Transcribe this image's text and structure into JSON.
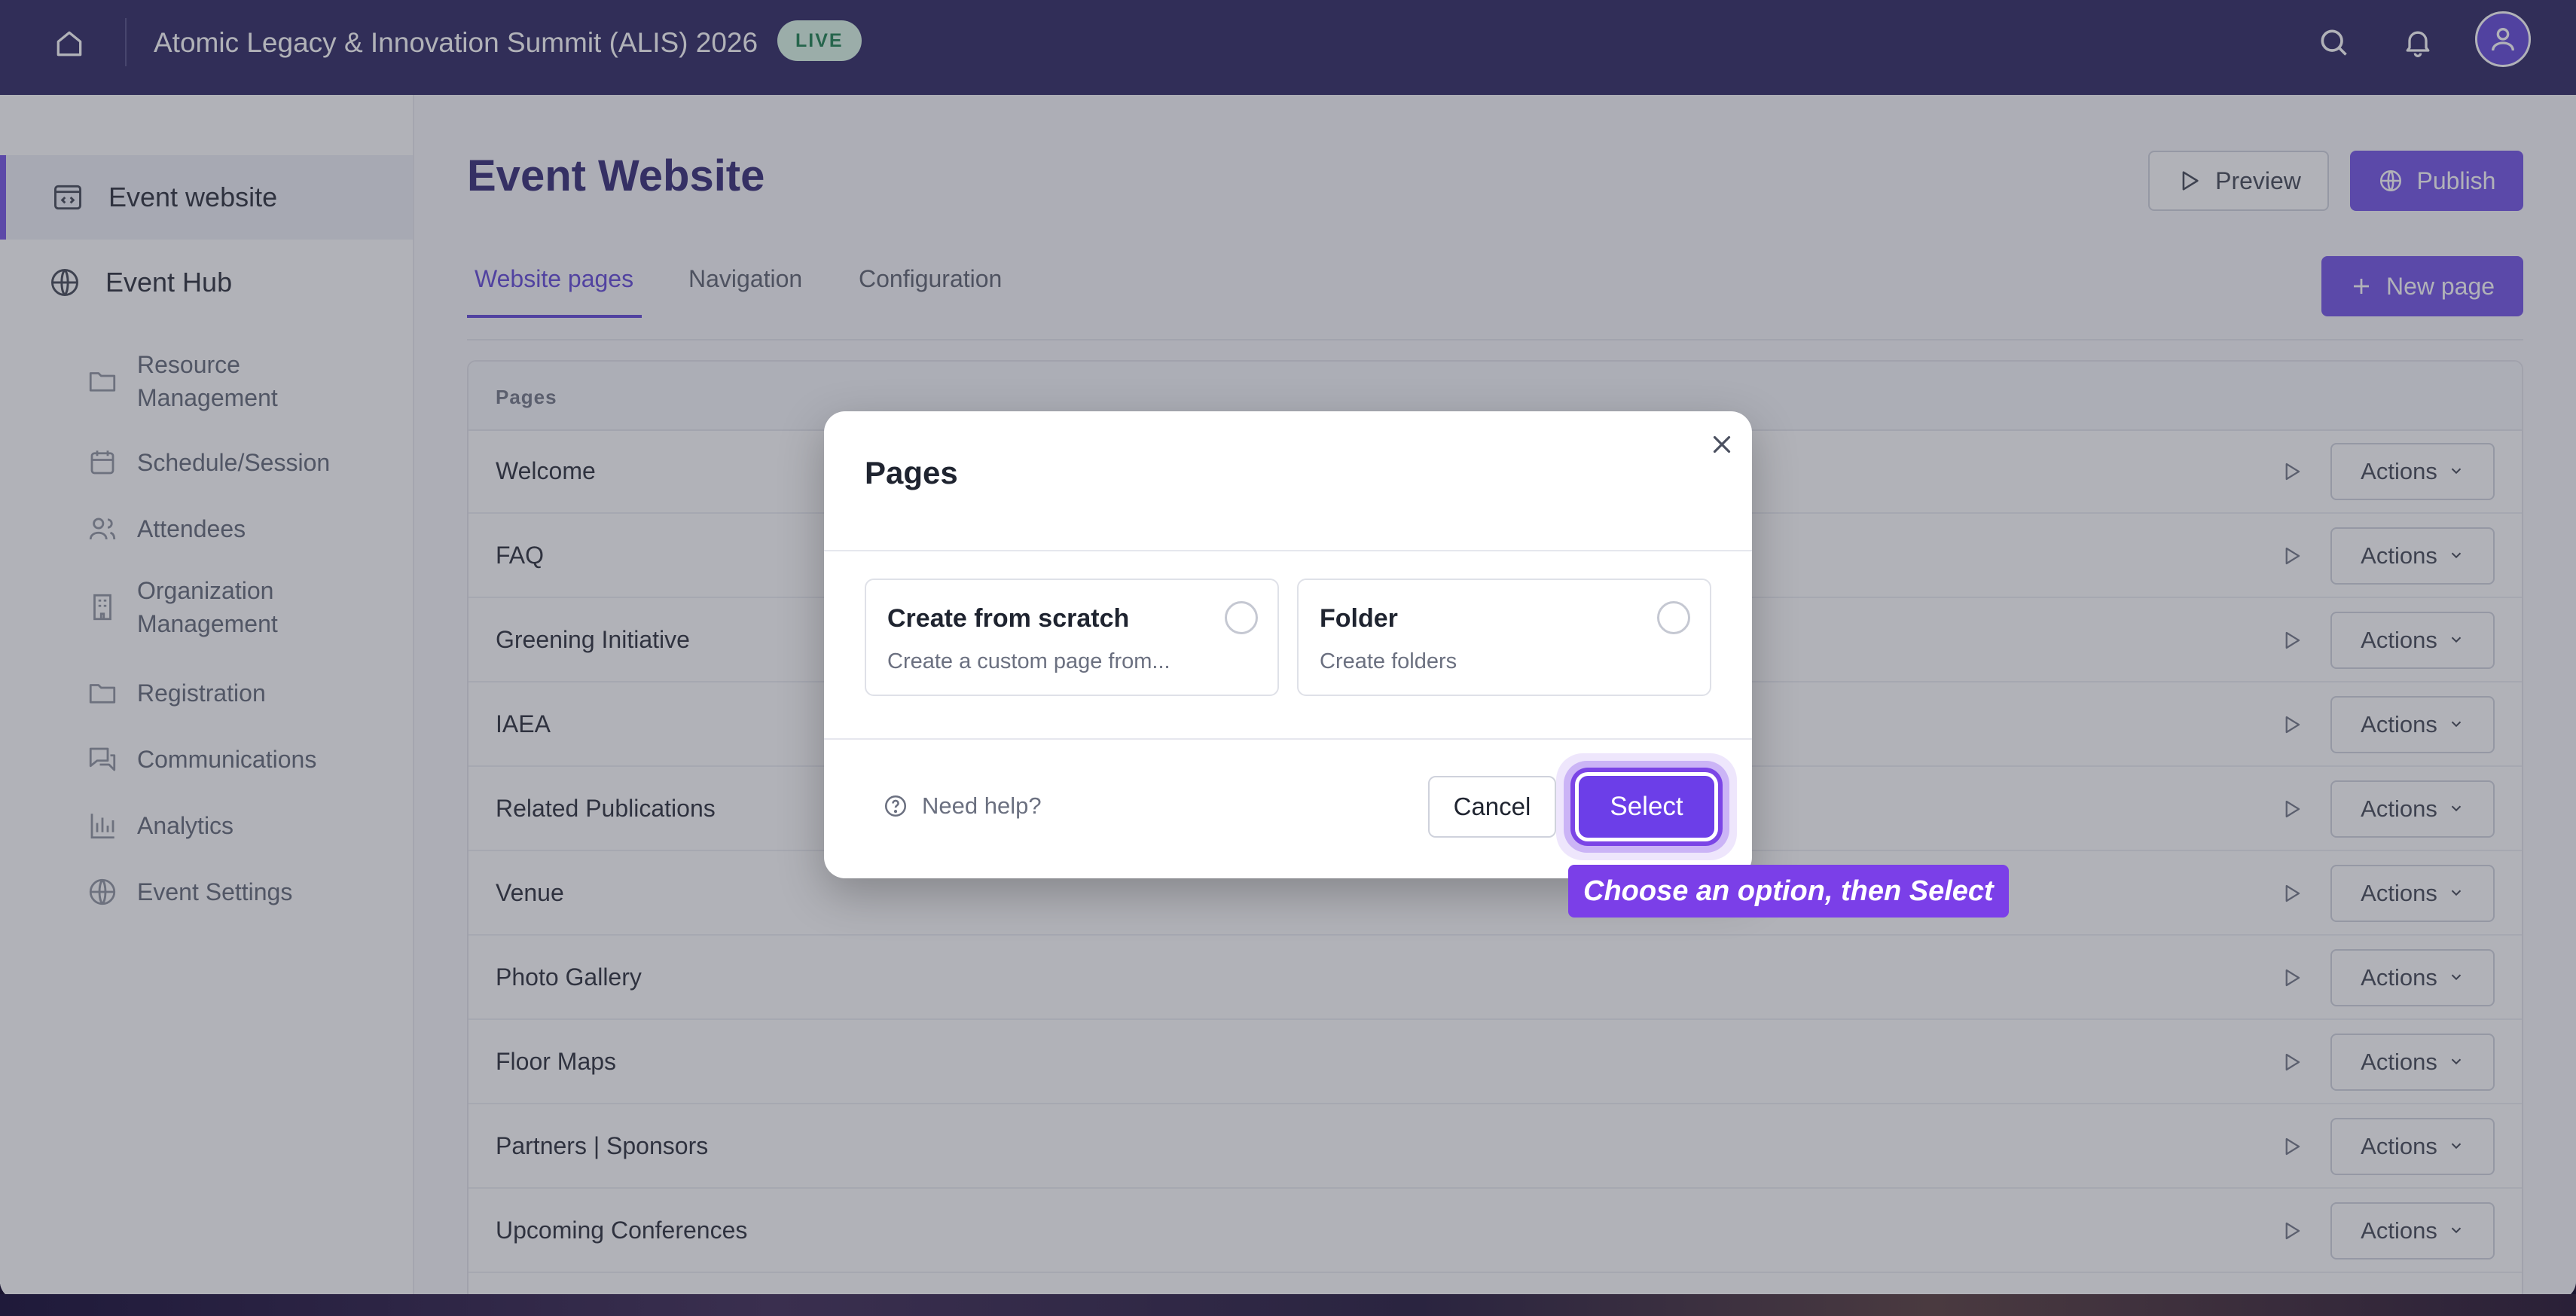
{
  "topbar": {
    "event_title": "Atomic Legacy & Innovation Summit (ALIS) 2026",
    "live_badge": "LIVE",
    "icons": [
      "home-icon",
      "search-icon",
      "bell-icon",
      "user-icon"
    ]
  },
  "sidebar": {
    "main_items": [
      {
        "label": "Event website",
        "icon": "browser-code-icon",
        "active": true
      },
      {
        "label": "Event Hub",
        "icon": "globe-icon",
        "active": false
      }
    ],
    "sub_items": [
      {
        "label": "Resource\nManagement",
        "line1": "Resource",
        "line2": "Management",
        "icon": "folder-icon"
      },
      {
        "label": "Schedule/Session",
        "icon": "calendar-icon"
      },
      {
        "label": "Attendees",
        "icon": "users-icon"
      },
      {
        "label": "Organization Management",
        "line1": "Organization",
        "line2": "Management",
        "icon": "building-icon"
      },
      {
        "label": "Registration",
        "icon": "folder-icon"
      },
      {
        "label": "Communications",
        "icon": "chat-icon"
      },
      {
        "label": "Analytics",
        "icon": "bar-chart-icon"
      },
      {
        "label": "Event Settings",
        "icon": "globe-icon"
      }
    ]
  },
  "main": {
    "title": "Event Website",
    "preview_label": "Preview",
    "publish_label": "Publish",
    "new_page_label": "New page",
    "tabs": [
      {
        "label": "Website pages",
        "active": true
      },
      {
        "label": "Navigation",
        "active": false
      },
      {
        "label": "Configuration",
        "active": false
      }
    ],
    "table": {
      "header": "Pages",
      "actions_label": "Actions",
      "rows": [
        "Welcome",
        "FAQ",
        "Greening Initiative",
        "IAEA",
        "Related Publications",
        "Venue",
        "Photo Gallery",
        "Floor Maps",
        "Partners | Sponsors",
        "Upcoming Conferences"
      ]
    }
  },
  "modal": {
    "title": "Pages",
    "options": [
      {
        "title": "Create from scratch",
        "description": "Create a custom page from...",
        "selected": false
      },
      {
        "title": "Folder",
        "description": "Create folders",
        "selected": false
      }
    ],
    "help_label": "Need help?",
    "cancel_label": "Cancel",
    "select_label": "Select"
  },
  "tooltip": {
    "text": "Choose an option, then Select"
  },
  "colors": {
    "topbar": "#231d5a",
    "accent": "#6c4be6",
    "title": "#2a1f6f",
    "live_bg": "#d9f7e6",
    "live_text": "#117a46"
  }
}
